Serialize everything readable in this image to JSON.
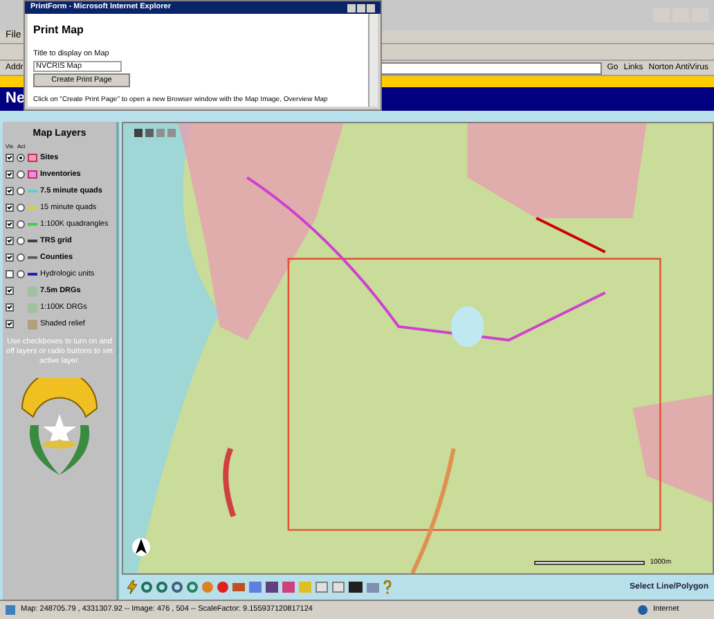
{
  "browser": {
    "menu": "File",
    "address_label": "Addr",
    "go": "Go",
    "links": "Links",
    "norton": "Norton AntiVirus",
    "banner": "Ne"
  },
  "popup": {
    "title": "PrintForm - Microsoft Internet Explorer",
    "heading": "Print Map",
    "field_label": "Title to display on Map",
    "field_value": "NVCRIS Map",
    "button": "Create Print Page",
    "note": "Click on \"Create Print Page\" to open a new Browser window with the Map Image, Overview Map"
  },
  "layers": {
    "title": "Map Layers",
    "col_visible": "Vis",
    "col_active": "Act",
    "items": [
      {
        "label": "Sites",
        "bold": true,
        "visible": true,
        "kind": "polygon",
        "selected": true,
        "color": "#f4a0a8"
      },
      {
        "label": "Inventories",
        "bold": true,
        "visible": true,
        "kind": "polygon",
        "selected": false,
        "color": "#f08ce8"
      },
      {
        "label": "7.5 minute quads",
        "bold": true,
        "visible": true,
        "kind": "line",
        "selected": false,
        "color": "#60d0c0"
      },
      {
        "label": "15 minute quads",
        "bold": false,
        "visible": true,
        "kind": "line",
        "selected": false,
        "color": "#d0d040"
      },
      {
        "label": "1:100K quadrangles",
        "bold": false,
        "visible": true,
        "kind": "line",
        "selected": false,
        "color": "#40d040"
      },
      {
        "label": "TRS grid",
        "bold": true,
        "visible": true,
        "kind": "line",
        "selected": false,
        "color": "#404040"
      },
      {
        "label": "Counties",
        "bold": true,
        "visible": true,
        "kind": "line",
        "selected": false,
        "color": "#606060"
      },
      {
        "label": "Hydrologic units",
        "bold": false,
        "visible": false,
        "kind": "line",
        "selected": false,
        "color": "#2020c0"
      },
      {
        "label": "7.5m DRGs",
        "bold": true,
        "visible": true,
        "kind": "image"
      },
      {
        "label": "1:100K DRGs",
        "bold": false,
        "visible": true,
        "kind": "image"
      },
      {
        "label": "Shaded relief",
        "bold": false,
        "visible": true,
        "kind": "relief"
      }
    ],
    "hint": "Use checkboxes to turn on and off layers or radio buttons to set active layer."
  },
  "map": {
    "scale_label": "1000m"
  },
  "toolbar": {
    "mode": "Select Line/Polygon"
  },
  "status_bar": {
    "text": "Map: 248705.79 , 4331307.92 -- Image: 476 , 504 -- ScaleFactor: 9.155937120817124",
    "zone": "Internet"
  }
}
